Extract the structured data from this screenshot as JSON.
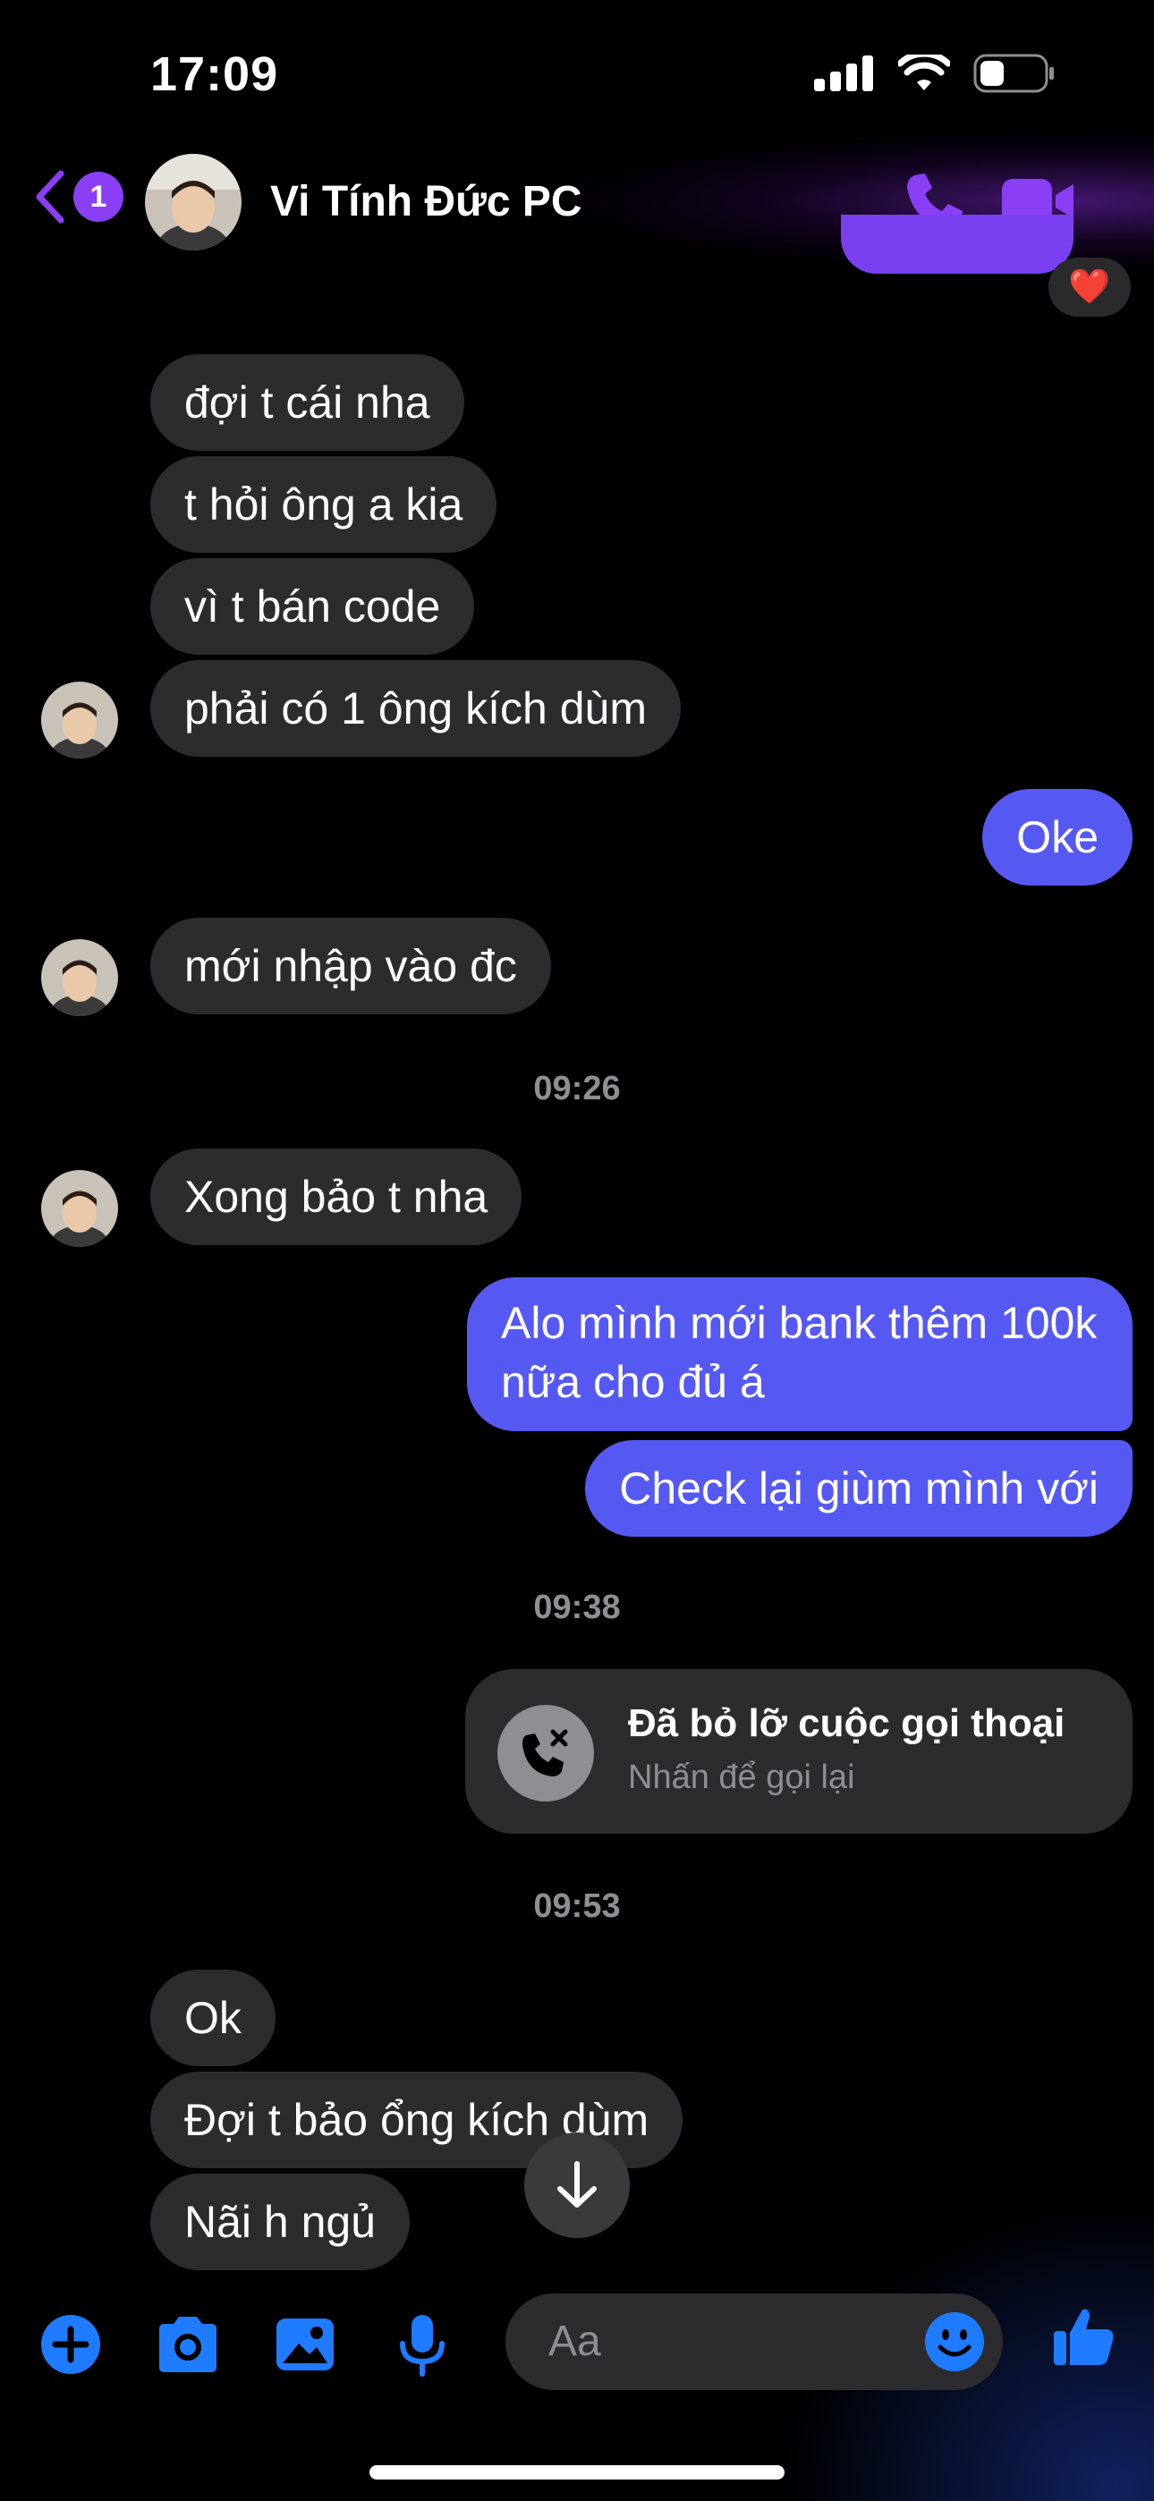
{
  "status_bar": {
    "time": "17:09"
  },
  "header": {
    "back_badge": "1",
    "contact_name": "Vi Tính Đức PC",
    "reaction": "❤️"
  },
  "colors": {
    "accent": "#8a3ff5",
    "sent_bubble": "#5659f1",
    "received_bubble": "#2c2c2e",
    "composer_icons": "#1f7bff"
  },
  "messages": [
    {
      "side": "received",
      "text": "đợi t cái nha"
    },
    {
      "side": "received",
      "text": "t hỏi ông a kia"
    },
    {
      "side": "received",
      "text": "vì t bán code"
    },
    {
      "side": "received",
      "text": "phải có 1 ông kích dùm"
    },
    {
      "side": "sent",
      "text": "Oke"
    },
    {
      "side": "received",
      "text": "mới nhập vào đc"
    },
    {
      "side": "timestamp",
      "text": "09:26"
    },
    {
      "side": "received",
      "text": "Xong bảo t nha"
    },
    {
      "side": "sent",
      "text": "Alo mình mới bank thêm 100k nữa cho đủ á"
    },
    {
      "side": "sent",
      "text": "Check lại giùm mình với"
    },
    {
      "side": "timestamp",
      "text": "09:38"
    },
    {
      "side": "timestamp",
      "text": "09:53"
    },
    {
      "side": "received",
      "text": "Ok"
    },
    {
      "side": "received",
      "text": "Đợi t bảo ổng kích dùm"
    },
    {
      "side": "received",
      "text": "Nãi h ngủ"
    }
  ],
  "missed_call": {
    "title": "Đã bỏ lỡ cuộc gọi thoại",
    "subtitle": "Nhấn để gọi lại",
    "icon": "missed-call-icon"
  },
  "composer": {
    "placeholder": "Aa"
  }
}
